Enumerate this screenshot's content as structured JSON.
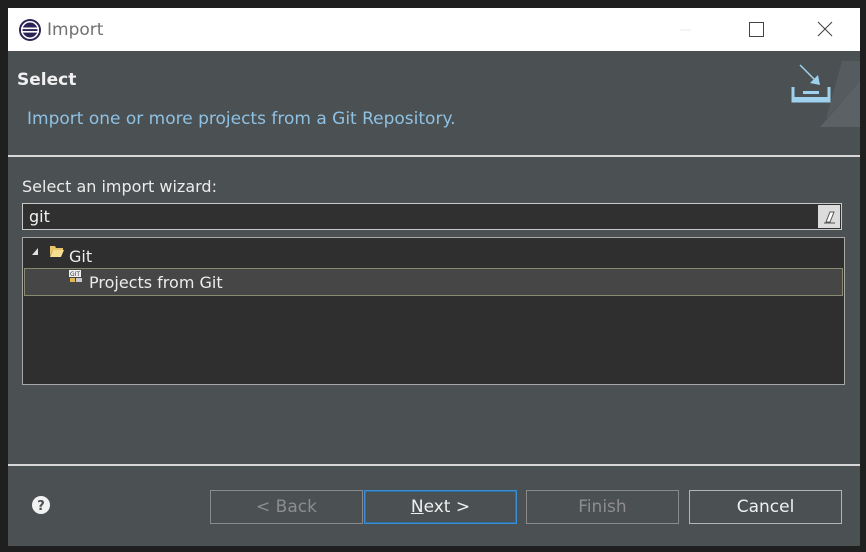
{
  "window": {
    "title": "Import",
    "icon": "eclipse-icon",
    "controls": [
      "minimize-icon",
      "maximize-icon",
      "close-icon"
    ]
  },
  "header": {
    "title": "Select",
    "description": "Import one or more projects from a Git Repository.",
    "banner_icon": "import-wizard-icon"
  },
  "wizard": {
    "label": "Select an import wizard:",
    "filter_value": "git",
    "clear_icon": "eraser-icon",
    "tree": [
      {
        "label": "Git",
        "icon": "folder-open-icon",
        "expanded": true,
        "children": [
          {
            "label": "Projects from Git",
            "icon": "git-projects-icon",
            "selected": true
          }
        ]
      }
    ]
  },
  "footer": {
    "help_icon": "help-icon",
    "back": "< Back",
    "next_mnemonic": "N",
    "next_rest": "ext >",
    "finish": "Finish",
    "cancel": "Cancel"
  },
  "colors": {
    "dialog_bg": "#4b5053",
    "tree_bg": "#2f2f2f",
    "description": "#8fc1e3",
    "focus_border": "#3c8fd6"
  }
}
